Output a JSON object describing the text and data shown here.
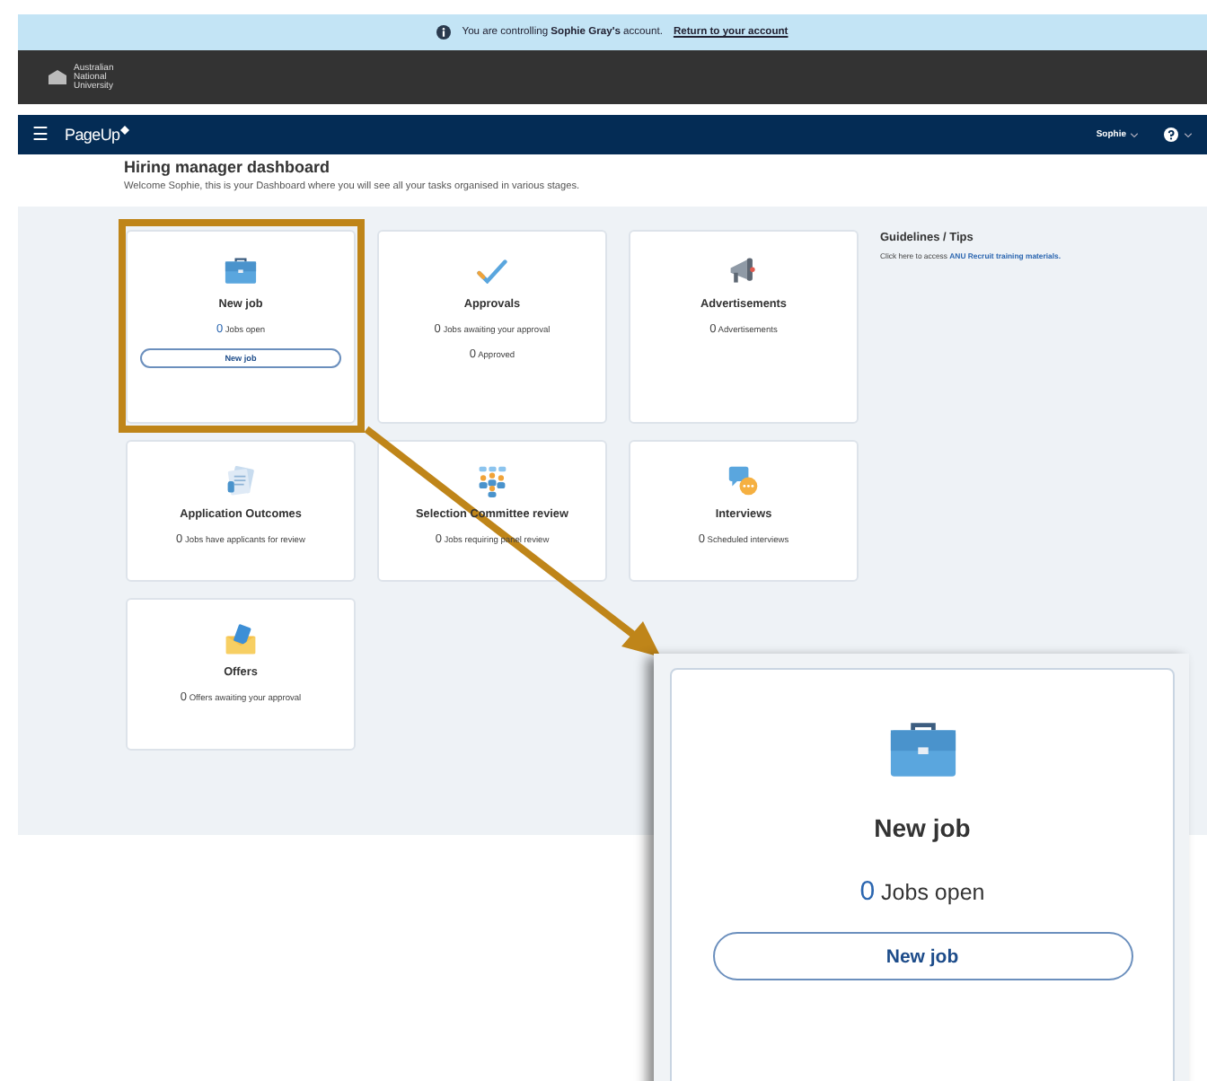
{
  "banner": {
    "message": "You are controlling **Sophie Gray's** account.",
    "link": "Return to your account"
  },
  "org_bar": {
    "logo_text": "Australian National University"
  },
  "nav": {
    "menu_glyph": "☰",
    "brand": "PageUp",
    "user": "Sophie"
  },
  "page": {
    "title": "Hiring manager dashboard",
    "welcome": "Welcome Sophie, this is your Dashboard where you will see all your tasks organised in various stages."
  },
  "cards": [
    {
      "kind": "briefcase",
      "title": "New job",
      "highlighted": true,
      "stats": [
        {
          "count": "0",
          "label": "Jobs open"
        }
      ],
      "button": "New job"
    },
    {
      "kind": "check",
      "title": "Approvals",
      "highlighted": false,
      "stats": [
        {
          "count": "0",
          "label": "Jobs awaiting your approval"
        },
        {
          "count": "0",
          "label": "Approved"
        }
      ]
    },
    {
      "kind": "megaphone",
      "title": "Advertisements",
      "highlighted": false,
      "stats": [
        {
          "count": "0",
          "label": "Advertisements"
        }
      ]
    },
    {
      "kind": "document",
      "title": "Application Outcomes",
      "highlighted": false,
      "stats": [
        {
          "count": "0",
          "label": "Jobs have applicants for review"
        }
      ]
    },
    {
      "kind": "people",
      "title": "Selection Committee review",
      "highlighted": false,
      "stats": [
        {
          "count": "0",
          "label": "Jobs requiring panel review"
        }
      ]
    },
    {
      "kind": "chat",
      "title": "Interviews",
      "highlighted": false,
      "stats": [
        {
          "count": "0",
          "label": "Scheduled interviews"
        }
      ]
    },
    {
      "kind": "envelope",
      "title": "Offers",
      "highlighted": false,
      "stats": [
        {
          "count": "0",
          "label": "Offers awaiting your approval"
        }
      ]
    }
  ],
  "guidelines": {
    "title": "Guidelines / Tips",
    "text": "Click here to access",
    "link": "ANU Recruit training materials."
  },
  "callout": {
    "kind": "briefcase",
    "title": "New job",
    "count": "0",
    "label": "Jobs open",
    "button": "New job"
  }
}
